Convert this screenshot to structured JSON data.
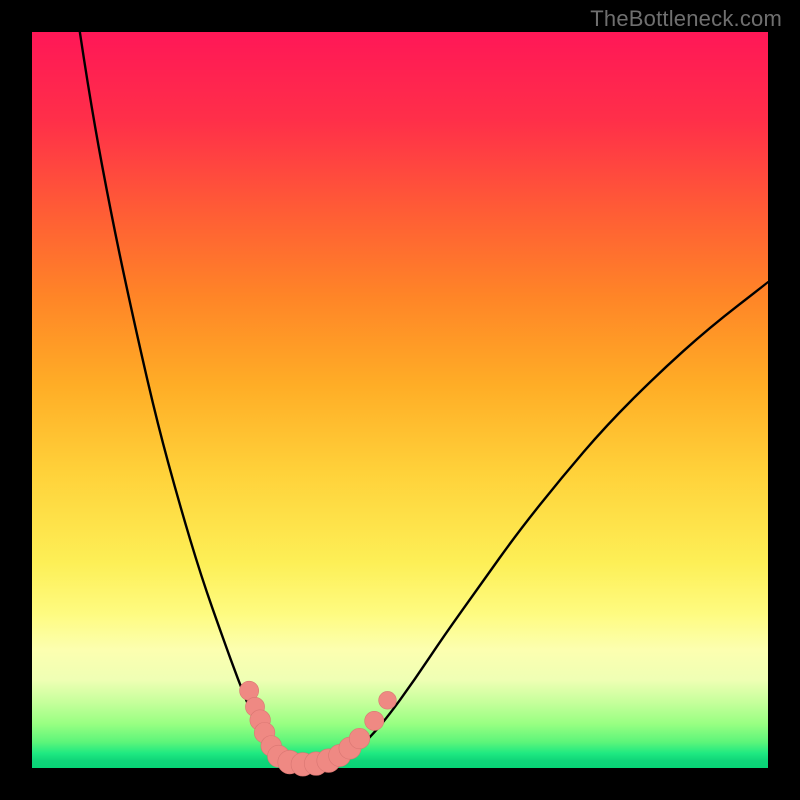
{
  "watermark": "TheBottleneck.com",
  "colors": {
    "frame": "#000000",
    "curve_stroke": "#000000",
    "marker_fill": "#ef8983",
    "marker_stroke": "#d97672"
  },
  "chart_data": {
    "type": "line",
    "title": "",
    "xlabel": "",
    "ylabel": "",
    "xlim": [
      0,
      100
    ],
    "ylim": [
      0,
      100
    ],
    "grid": false,
    "legend": false,
    "curve": [
      {
        "x": 6.5,
        "y": 100
      },
      {
        "x": 8,
        "y": 90
      },
      {
        "x": 11,
        "y": 74
      },
      {
        "x": 14,
        "y": 60
      },
      {
        "x": 17,
        "y": 47
      },
      {
        "x": 20,
        "y": 36
      },
      {
        "x": 23,
        "y": 26
      },
      {
        "x": 26,
        "y": 17.5
      },
      {
        "x": 28,
        "y": 12
      },
      {
        "x": 30,
        "y": 7
      },
      {
        "x": 31.5,
        "y": 3.5
      },
      {
        "x": 33,
        "y": 1.2
      },
      {
        "x": 35,
        "y": 0.4
      },
      {
        "x": 38,
        "y": 0.3
      },
      {
        "x": 41,
        "y": 0.6
      },
      {
        "x": 43,
        "y": 1.5
      },
      {
        "x": 45,
        "y": 3.2
      },
      {
        "x": 48,
        "y": 6.5
      },
      {
        "x": 52,
        "y": 12
      },
      {
        "x": 56,
        "y": 18
      },
      {
        "x": 61,
        "y": 25
      },
      {
        "x": 66,
        "y": 32
      },
      {
        "x": 72,
        "y": 39.5
      },
      {
        "x": 78,
        "y": 46.5
      },
      {
        "x": 85,
        "y": 53.5
      },
      {
        "x": 92,
        "y": 59.8
      },
      {
        "x": 100,
        "y": 66
      }
    ],
    "markers": [
      {
        "x": 29.5,
        "y": 10.5,
        "r": 1.3
      },
      {
        "x": 30.3,
        "y": 8.3,
        "r": 1.3
      },
      {
        "x": 31.0,
        "y": 6.5,
        "r": 1.4
      },
      {
        "x": 31.6,
        "y": 4.8,
        "r": 1.4
      },
      {
        "x": 32.5,
        "y": 3.0,
        "r": 1.4
      },
      {
        "x": 33.5,
        "y": 1.6,
        "r": 1.5
      },
      {
        "x": 35.0,
        "y": 0.8,
        "r": 1.6
      },
      {
        "x": 36.8,
        "y": 0.5,
        "r": 1.6
      },
      {
        "x": 38.6,
        "y": 0.6,
        "r": 1.6
      },
      {
        "x": 40.3,
        "y": 1.0,
        "r": 1.6
      },
      {
        "x": 41.8,
        "y": 1.7,
        "r": 1.5
      },
      {
        "x": 43.2,
        "y": 2.7,
        "r": 1.5
      },
      {
        "x": 44.5,
        "y": 4.0,
        "r": 1.4
      },
      {
        "x": 46.5,
        "y": 6.4,
        "r": 1.3
      },
      {
        "x": 48.3,
        "y": 9.2,
        "r": 1.2
      }
    ]
  }
}
